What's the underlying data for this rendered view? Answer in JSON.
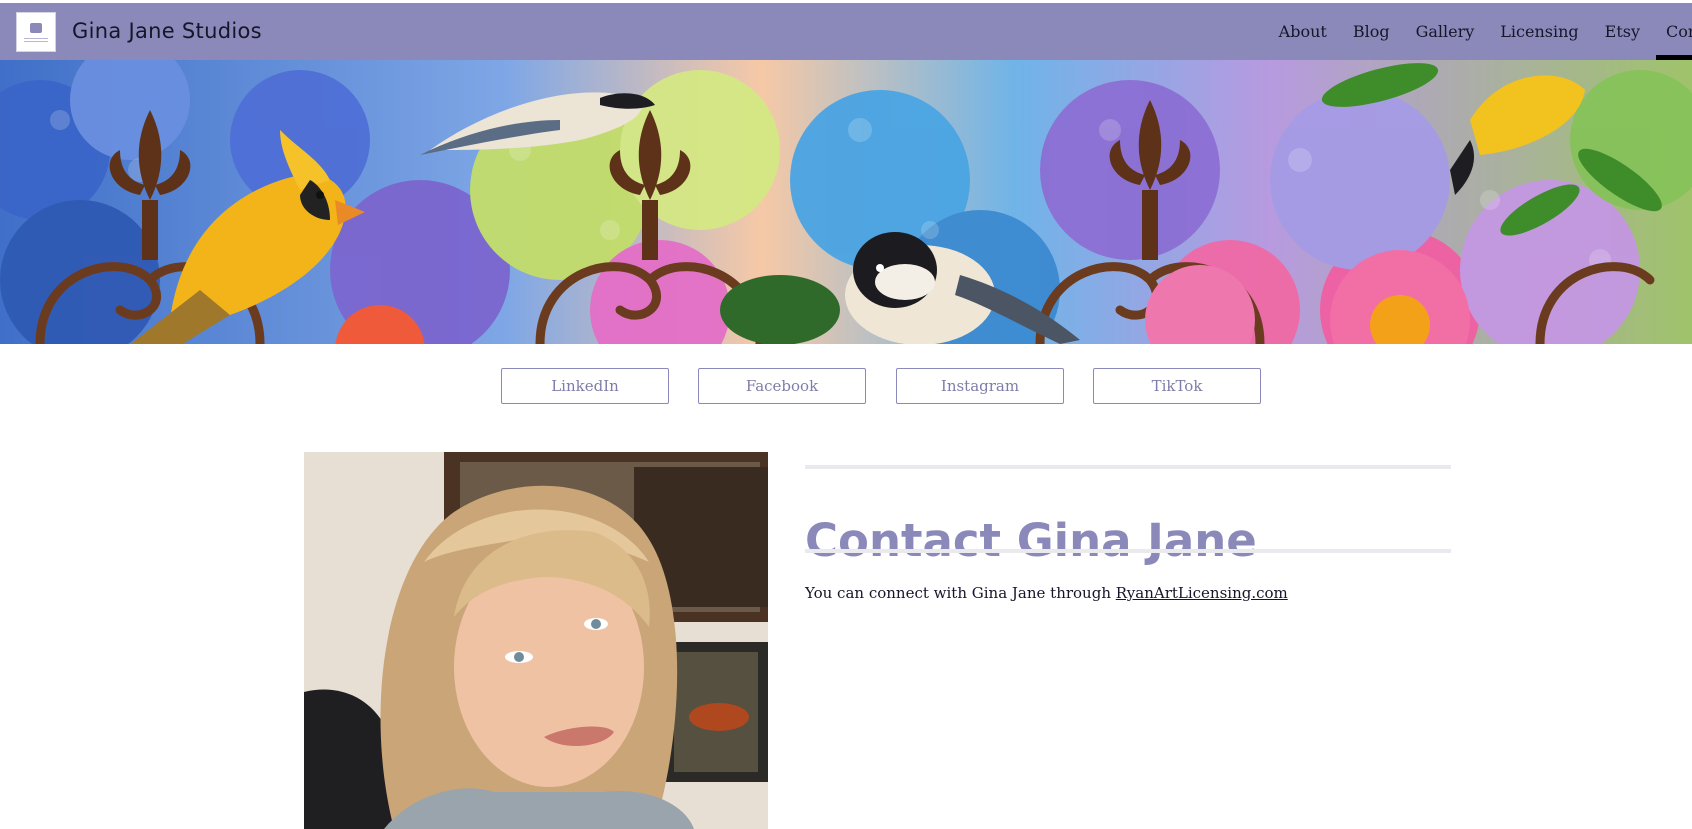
{
  "site": {
    "title": "Gina Jane Studios",
    "logo_icon": "studio-logo-icon"
  },
  "nav": {
    "items": [
      {
        "label": "About"
      },
      {
        "label": "Blog"
      },
      {
        "label": "Gallery"
      },
      {
        "label": "Licensing"
      },
      {
        "label": "Etsy"
      },
      {
        "label": "Cont"
      }
    ],
    "active_index": 5
  },
  "banner": {
    "image_name": "garden-birds-banner"
  },
  "social": {
    "buttons": [
      {
        "label": "LinkedIn"
      },
      {
        "label": "Facebook"
      },
      {
        "label": "Instagram"
      },
      {
        "label": "TikTok"
      }
    ]
  },
  "portrait": {
    "image_name": "gina-jane-portrait"
  },
  "contact": {
    "title": "Contact Gina Jane",
    "text_prefix": "You can connect with Gina Jane through ",
    "link_text": "RyanArtLicensing.com"
  },
  "colors": {
    "accent": "#8b89b9",
    "text": "#16162a",
    "button_text": "#7f7da8"
  }
}
